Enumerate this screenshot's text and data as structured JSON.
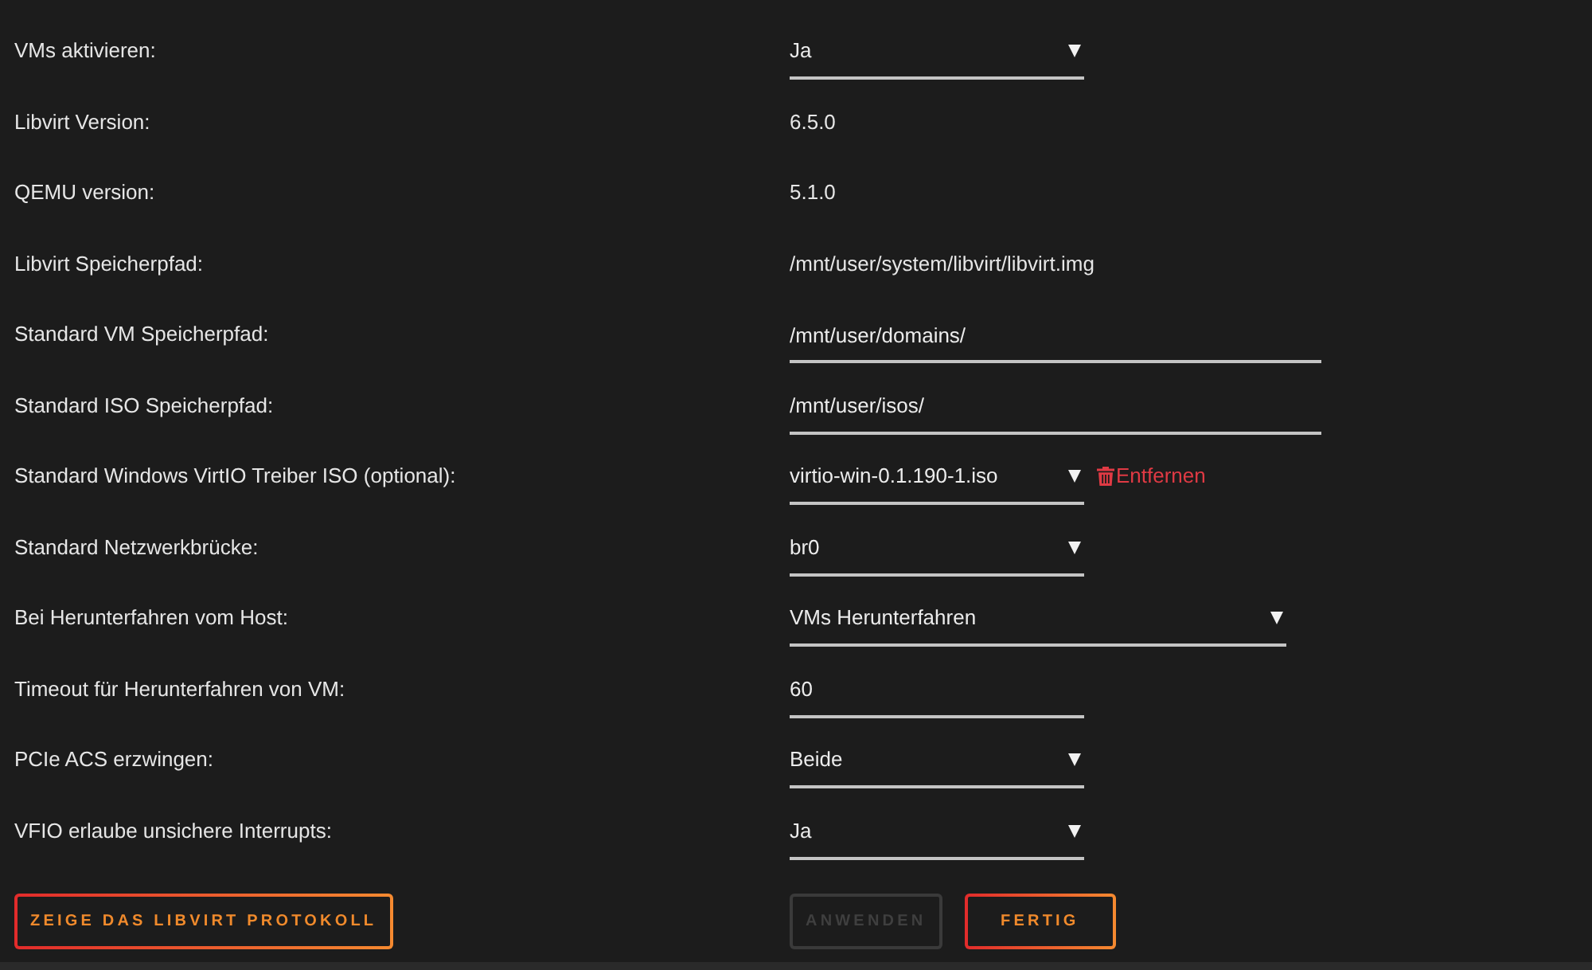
{
  "settings": [
    {
      "label": "VMs aktivieren:",
      "kind": "select",
      "value": "Ja"
    },
    {
      "label": "Libvirt Version:",
      "kind": "text",
      "value": "6.5.0"
    },
    {
      "label": "QEMU version:",
      "kind": "text",
      "value": "5.1.0"
    },
    {
      "label": "Libvirt Speicherpfad:",
      "kind": "text",
      "value": "/mnt/user/system/libvirt/libvirt.img"
    },
    {
      "label": "Standard VM Speicherpfad:",
      "kind": "input",
      "value": "/mnt/user/domains/"
    },
    {
      "label": "Standard ISO Speicherpfad:",
      "kind": "input",
      "value": "/mnt/user/isos/"
    },
    {
      "label": "Standard Windows VirtIO Treiber ISO (optional):",
      "kind": "select",
      "value": "virtio-win-0.1.190-1.iso",
      "remove_link": "Entfernen"
    },
    {
      "label": "Standard Netzwerkbrücke:",
      "kind": "select",
      "value": "br0"
    },
    {
      "label": "Bei Herunterfahren vom Host:",
      "kind": "select",
      "value": "VMs Herunterfahren"
    },
    {
      "label": "Timeout für Herunterfahren von VM:",
      "kind": "input",
      "value": "60"
    },
    {
      "label": "PCIe ACS erzwingen:",
      "kind": "select",
      "value": "Beide"
    },
    {
      "label": "VFIO erlaube unsichere Interrupts:",
      "kind": "select",
      "value": "Ja"
    }
  ],
  "log_button": {
    "label": "ZEIGE DAS LIBVIRT PROTOKOLL",
    "disabled": false
  },
  "actions": [
    {
      "label": "ANWENDEN",
      "disabled": true
    },
    {
      "label": "FERTIG",
      "disabled": false
    }
  ]
}
